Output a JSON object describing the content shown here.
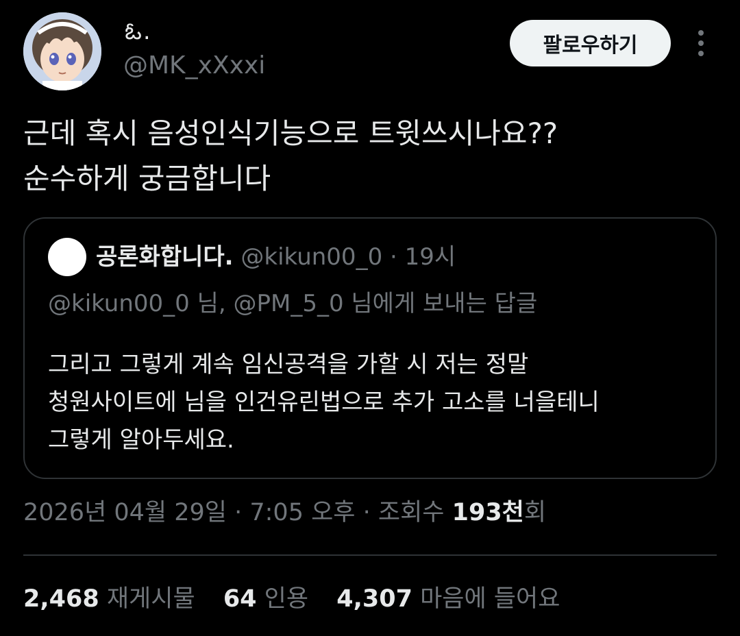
{
  "author": {
    "display_name": "ఓ.",
    "handle": "@MK_xXxxi"
  },
  "header": {
    "follow_label": "팔로우하기"
  },
  "tweet": {
    "text_lines": [
      "근데 혹시 음성인식기능으로 트윗쓰시나요??",
      "순수하게 궁금합니다"
    ]
  },
  "quote": {
    "name": "공론화합니다.",
    "meta": "@kikun00_0 · 19시",
    "reply_to": "@kikun00_0 님, @PM_5_0 님에게 보내는 답글",
    "body_lines": [
      "그리고 그렇게 계속 임신공격을 가할 시 저는 정말",
      "청원사이트에 님을 인건유린법으로 추가 고소를 너을테니",
      "그렇게 알아두세요."
    ]
  },
  "meta": {
    "timestamp": "2026년 04월 29일 · 7:05 오후 · 조회수 ",
    "views_count": "193천",
    "views_suffix": "회"
  },
  "stats": {
    "retweets_count": "2,468",
    "retweets_label": "재게시물",
    "quotes_count": "64",
    "quotes_label": "인용",
    "likes_count": "4,307",
    "likes_label": "마음에 들어요"
  },
  "icons": {
    "more": "more-vertical-icon"
  },
  "colors": {
    "background": "#000000",
    "primary_text": "#e7e9ea",
    "secondary_text": "#71767b",
    "border": "#2f3336",
    "follow_bg": "#eff3f4"
  }
}
